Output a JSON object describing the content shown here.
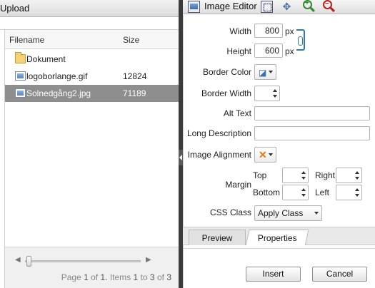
{
  "upload": {
    "title": "Upload",
    "columns": {
      "filename": "Filename",
      "size": "Size"
    },
    "files": [
      {
        "name": "Dokument",
        "size": "",
        "type": "folder-icon"
      },
      {
        "name": "logoborlange.gif",
        "size": "12824",
        "type": "image-file-icon"
      },
      {
        "name": "Solnedgång2.jpg",
        "size": "71189",
        "type": "image-file-icon",
        "selected": true
      }
    ],
    "pager": {
      "prefix": "Page",
      "page": "1",
      "of_word": "of",
      "pages": "1.",
      "items_word": "Items",
      "from": "1",
      "to_word": "to",
      "to": "3",
      "of_word2": "of",
      "total": "3"
    }
  },
  "editor": {
    "title": "Image Editor",
    "width_label": "Width",
    "width_value": "800",
    "width_unit": "px",
    "height_label": "Height",
    "height_value": "600",
    "height_unit": "px",
    "border_color_label": "Border Color",
    "border_width_label": "Border Width",
    "border_width_value": "",
    "alt_text_label": "Alt Text",
    "alt_text_value": "",
    "long_desc_label": "Long Description",
    "long_desc_value": "",
    "image_alignment_label": "Image Alignment",
    "margin_label": "Margin",
    "margin_top_label": "Top",
    "margin_bottom_label": "Bottom",
    "margin_right_label": "Right",
    "margin_left_label": "Left",
    "css_class_label": "CSS Class",
    "css_class_value": "Apply Class",
    "tabs": {
      "preview": "Preview",
      "properties": "Properties"
    },
    "buttons": {
      "insert": "Insert",
      "cancel": "Cancel"
    }
  },
  "colors": {
    "selected_row": "#8e8e8e",
    "divider": "#3b3b3b",
    "chain": "#2d7ab8"
  }
}
